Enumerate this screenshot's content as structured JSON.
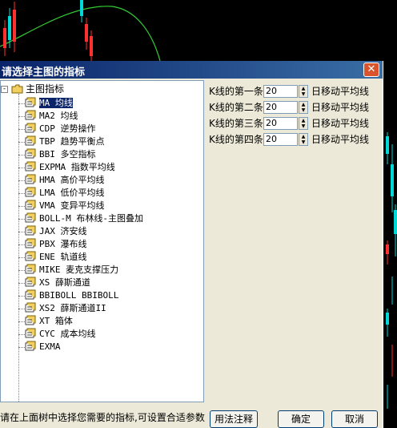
{
  "dialog": {
    "title": "请选择主图的指标",
    "close_label": "✕"
  },
  "tree": {
    "root_label": "主图指标",
    "expander": "-",
    "items": [
      "MA 均线",
      "MA2 均线",
      "CDP 逆势操作",
      "TBP 趋势平衡点",
      "BBI 多空指标",
      "EXPMA 指数平均线",
      "HMA 高价平均线",
      "LMA 低价平均线",
      "VMA 变异平均线",
      "BOLL-M 布林线-主图叠加",
      "JAX 济安线",
      "PBX 瀑布线",
      "ENE 轨道线",
      "MIKE 麦克支撑压力",
      "XS 薛斯通道",
      "BBIBOLL BBIBOLL",
      "XS2 薛斯通道II",
      "XT 箱体",
      "CYC 成本均线",
      "EXMA"
    ],
    "selected_index": 0
  },
  "params": [
    {
      "label": "K线的第一条",
      "value": "20",
      "suffix": "日移动平均线"
    },
    {
      "label": "K线的第二条",
      "value": "20",
      "suffix": "日移动平均线"
    },
    {
      "label": "K线的第三条",
      "value": "20",
      "suffix": "日移动平均线"
    },
    {
      "label": "K线的第四条",
      "value": "20",
      "suffix": "日移动平均线"
    }
  ],
  "status": {
    "text": "请在上面树中选择您需要的指标,可设置合适参数"
  },
  "buttons": {
    "usage": "用法注释",
    "ok": "确定",
    "cancel": "取消"
  },
  "colors": {
    "title_start": "#0a246a",
    "title_end": "#3a6ea5",
    "dialog_bg": "#ece9d8",
    "selection": "#0a246a",
    "chart_bg": "#000000",
    "candle_up": "#ff3030",
    "candle_down": "#00d8d8",
    "ma_line": "#33cc33"
  }
}
